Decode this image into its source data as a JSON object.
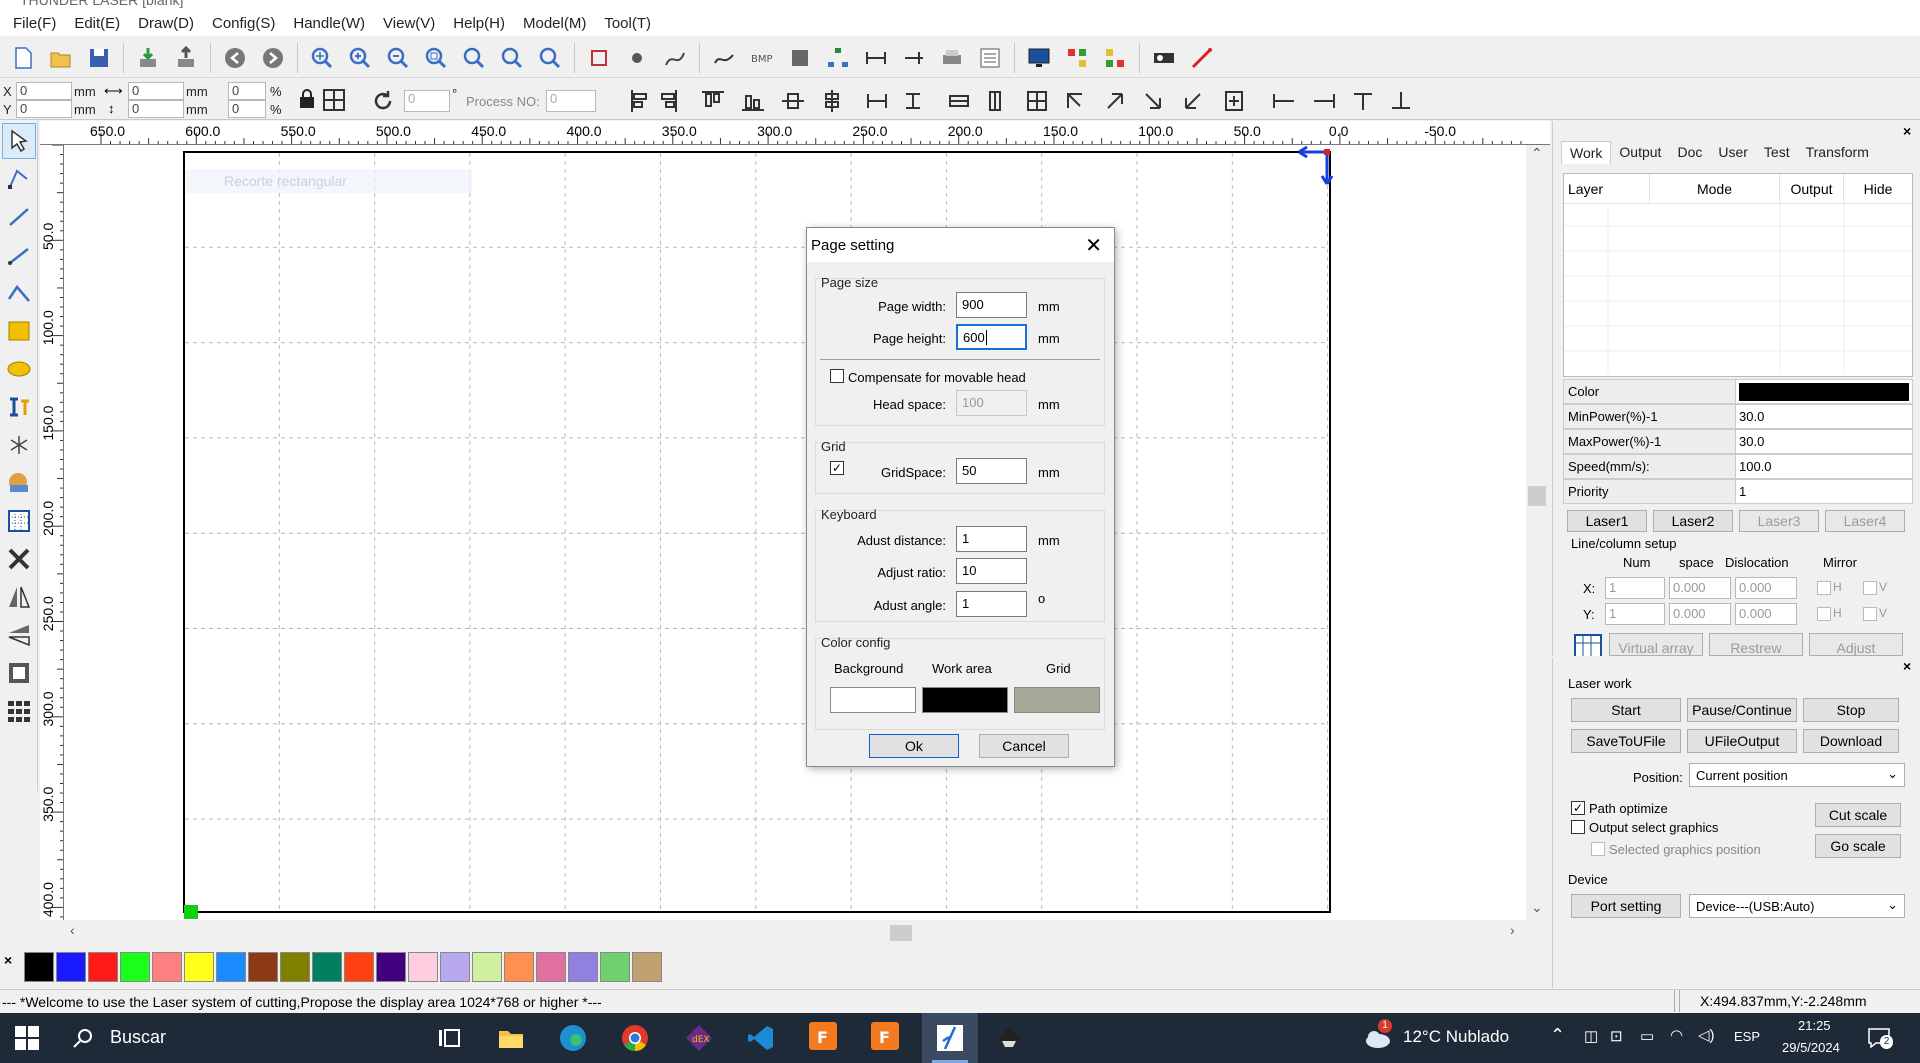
{
  "window": {
    "title": "THUNDER LASER [blank]"
  },
  "menu": [
    "File(F)",
    "Edit(E)",
    "Draw(D)",
    "Config(S)",
    "Handle(W)",
    "View(V)",
    "Help(H)",
    "Model(M)",
    "Tool(T)"
  ],
  "toolbar2": {
    "x_label": "X",
    "y_label": "Y",
    "x_value": "0",
    "y_value": "0",
    "unit_mm": "mm",
    "w_value": "0",
    "h_value": "0",
    "pct_label": "%",
    "pct_x": "0",
    "pct_y": "0",
    "rotate_value": "0",
    "degree": "°",
    "process_label": "Process NO:",
    "process_value": "0"
  },
  "ruler": {
    "h_ticks": [
      "650.0",
      "600.0",
      "550.0",
      "500.0",
      "450.0",
      "400.0",
      "350.0",
      "300.0",
      "250.0",
      "200.0",
      "150.0",
      "100.0",
      "50.0",
      "0.0",
      "-50.0"
    ],
    "v_ticks": [
      "50.0",
      "100.0",
      "150.0",
      "200.0",
      "250.0",
      "300.0",
      "350.0",
      "400.0"
    ]
  },
  "canvas": {
    "ghost_label": "Recorte rectangular"
  },
  "palette": {
    "colors": [
      "#000000",
      "#1a1aff",
      "#ff1a1a",
      "#1aff1a",
      "#ff8080",
      "#ffff1a",
      "#1a8cff",
      "#8b3a14",
      "#808000",
      "#008060",
      "#ff4010",
      "#400080",
      "#ffcce0",
      "#b8a8f0",
      "#d0f0a0",
      "#ff9050",
      "#e070a0",
      "#9080e0",
      "#70d070",
      "#c0a070"
    ]
  },
  "status": {
    "message": "--- *Welcome to use the Laser system of cutting,Propose the display area 1024*768 or higher *---",
    "coords": "X:494.837mm,Y:-2.248mm"
  },
  "right_panel": {
    "tabs": [
      "Work",
      "Output",
      "Doc",
      "User",
      "Test",
      "Transform"
    ],
    "layer_headers": [
      "Layer",
      "Mode",
      "Output",
      "Hide"
    ],
    "props": [
      {
        "k": "Color",
        "v": ""
      },
      {
        "k": "MinPower(%)-1",
        "v": "30.0"
      },
      {
        "k": "MaxPower(%)-1",
        "v": "30.0"
      },
      {
        "k": "Speed(mm/s):",
        "v": "100.0"
      },
      {
        "k": "Priority",
        "v": "1"
      }
    ],
    "lasers": [
      "Laser1",
      "Laser2",
      "Laser3",
      "Laser4"
    ],
    "linecol": {
      "title": "Line/column setup",
      "headers": [
        "Num",
        "space",
        "Dislocation",
        "Mirror"
      ],
      "x_label": "X:",
      "y_label": "Y:",
      "x": [
        "1",
        "0.000",
        "0.000"
      ],
      "y": [
        "1",
        "0.000",
        "0.000"
      ],
      "h": "H",
      "v": "V",
      "buttons": [
        "Virtual array",
        "Restrew",
        "Adjust"
      ]
    }
  },
  "laser_work": {
    "title": "Laser work",
    "buttons": [
      "Start",
      "Pause/Continue",
      "Stop",
      "SaveToUFile",
      "UFileOutput",
      "Download"
    ],
    "position_label": "Position:",
    "position_value": "Current position",
    "path_optimize": "Path optimize",
    "output_select": "Output select graphics",
    "selected_pos": "Selected graphics position",
    "cut_scale": "Cut scale",
    "go_scale": "Go scale",
    "device_title": "Device",
    "port_setting": "Port setting",
    "device_value": "Device---(USB:Auto)"
  },
  "dialog": {
    "title": "Page setting",
    "page_size": "Page size",
    "page_width_label": "Page width:",
    "page_width": "900",
    "page_height_label": "Page height:",
    "page_height": "600",
    "mm": "mm",
    "compensate": "Compensate for movable head",
    "head_space_label": "Head space:",
    "head_space": "100",
    "grid": "Grid",
    "gridspace_label": "GridSpace:",
    "gridspace": "50",
    "keyboard": "Keyboard",
    "adjust_distance_label": "Adust distance:",
    "adjust_distance": "1",
    "adjust_ratio_label": "Adjust ratio:",
    "adjust_ratio": "10",
    "adjust_angle_label": "Adust angle:",
    "adjust_angle": "1",
    "degree": "o",
    "color_config": "Color config",
    "bg_label": "Background",
    "work_label": "Work area",
    "grid_label": "Grid",
    "colors": {
      "background": "#ffffff",
      "work_area": "#000000",
      "grid": "#a8a898"
    },
    "ok": "Ok",
    "cancel": "Cancel"
  },
  "taskbar": {
    "search": "Buscar",
    "weather": "12°C Nublado",
    "lang": "ESP",
    "time": "21:25",
    "date": "29/5/2024",
    "weather_badge": "1",
    "notif": "2"
  }
}
